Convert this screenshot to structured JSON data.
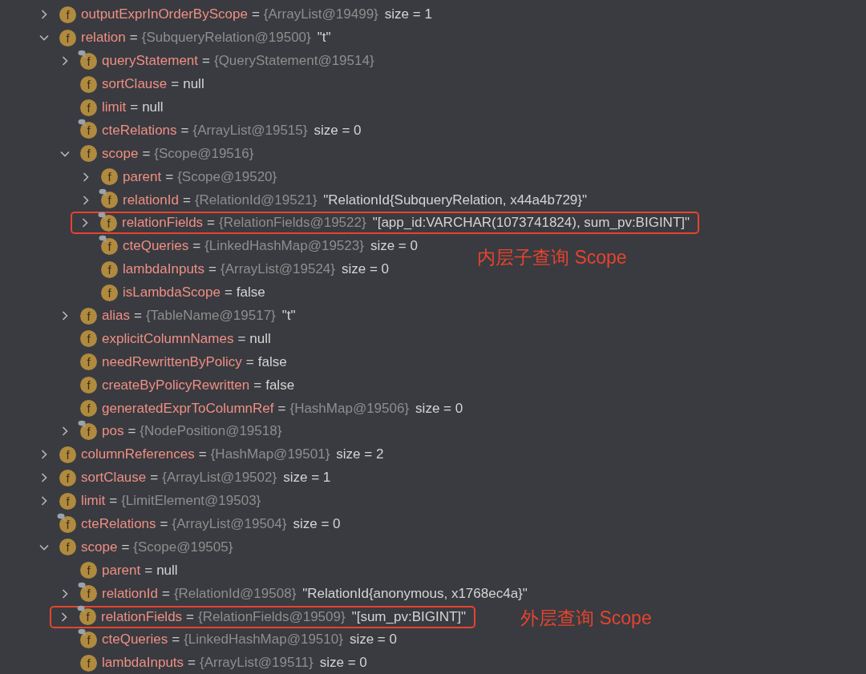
{
  "variables": [
    {
      "icon": "f",
      "name": "outputExprInOrderByScope",
      "eq": "=",
      "type": "{ArrayList@19499}",
      "value": "size = 1",
      "expanded": false,
      "pinned": false,
      "highlighted": false
    },
    {
      "icon": "f",
      "name": "relation",
      "eq": "=",
      "type": "{SubqueryRelation@19500}",
      "value": "\"t\"",
      "expanded": true,
      "pinned": false,
      "highlighted": false,
      "children": [
        {
          "icon": "f",
          "name": "queryStatement",
          "eq": "=",
          "type": "{QueryStatement@19514}",
          "expanded": false,
          "pinned": true,
          "highlighted": false
        },
        {
          "icon": "f",
          "name": "sortClause",
          "eq": "=",
          "value": "null",
          "pinned": false,
          "highlighted": false
        },
        {
          "icon": "f",
          "name": "limit",
          "eq": "=",
          "value": "null",
          "pinned": false,
          "highlighted": false
        },
        {
          "icon": "f",
          "name": "cteRelations",
          "eq": "=",
          "type": "{ArrayList@19515}",
          "value": "size = 0",
          "pinned": true,
          "highlighted": false
        },
        {
          "icon": "f",
          "name": "scope",
          "eq": "=",
          "type": "{Scope@19516}",
          "expanded": true,
          "pinned": false,
          "highlighted": false,
          "children": [
            {
              "icon": "f",
              "name": "parent",
              "eq": "=",
              "type": "{Scope@19520}",
              "expanded": false,
              "pinned": false,
              "highlighted": false
            },
            {
              "icon": "f",
              "name": "relationId",
              "eq": "=",
              "type": "{RelationId@19521}",
              "value": "\"RelationId{SubqueryRelation, x44a4b729}\"",
              "expanded": false,
              "pinned": true,
              "highlighted": false
            },
            {
              "icon": "f",
              "name": "relationFields",
              "eq": "=",
              "type": "{RelationFields@19522}",
              "value": "\"[app_id:VARCHAR(1073741824), sum_pv:BIGINT]\"",
              "expanded": false,
              "pinned": true,
              "highlighted": true,
              "annotation": {
                "text": "内层子查询 Scope",
                "kind": "below"
              }
            },
            {
              "icon": "f",
              "name": "cteQueries",
              "eq": "=",
              "type": "{LinkedHashMap@19523}",
              "value": "size = 0",
              "pinned": true,
              "highlighted": false
            },
            {
              "icon": "f",
              "name": "lambdaInputs",
              "eq": "=",
              "type": "{ArrayList@19524}",
              "value": "size = 0",
              "pinned": false,
              "highlighted": false
            },
            {
              "icon": "f",
              "name": "isLambdaScope",
              "eq": "=",
              "value": "false",
              "pinned": false,
              "highlighted": false
            }
          ]
        },
        {
          "icon": "f",
          "name": "alias",
          "eq": "=",
          "type": "{TableName@19517}",
          "value": "\"t\"",
          "expanded": false,
          "pinned": false,
          "highlighted": false
        },
        {
          "icon": "f",
          "name": "explicitColumnNames",
          "eq": "=",
          "value": "null",
          "pinned": false,
          "highlighted": false
        },
        {
          "icon": "f",
          "name": "needRewrittenByPolicy",
          "eq": "=",
          "value": "false",
          "pinned": false,
          "highlighted": false
        },
        {
          "icon": "f",
          "name": "createByPolicyRewritten",
          "eq": "=",
          "value": "false",
          "pinned": false,
          "highlighted": false
        },
        {
          "icon": "f",
          "name": "generatedExprToColumnRef",
          "eq": "=",
          "type": "{HashMap@19506}",
          "value": "size = 0",
          "pinned": false,
          "highlighted": false
        },
        {
          "icon": "f",
          "name": "pos",
          "eq": "=",
          "type": "{NodePosition@19518}",
          "expanded": false,
          "pinned": true,
          "highlighted": false
        }
      ]
    },
    {
      "icon": "f",
      "name": "columnReferences",
      "eq": "=",
      "type": "{HashMap@19501}",
      "value": "size = 2",
      "expanded": false,
      "pinned": false,
      "highlighted": false
    },
    {
      "icon": "f",
      "name": "sortClause",
      "eq": "=",
      "type": "{ArrayList@19502}",
      "value": "size = 1",
      "expanded": false,
      "pinned": false,
      "highlighted": false
    },
    {
      "icon": "f",
      "name": "limit",
      "eq": "=",
      "type": "{LimitElement@19503}",
      "expanded": false,
      "pinned": false,
      "highlighted": false
    },
    {
      "icon": "f",
      "name": "cteRelations",
      "eq": "=",
      "type": "{ArrayList@19504}",
      "value": "size = 0",
      "pinned": true,
      "highlighted": false
    },
    {
      "icon": "f",
      "name": "scope",
      "eq": "=",
      "type": "{Scope@19505}",
      "expanded": true,
      "pinned": false,
      "highlighted": false,
      "children": [
        {
          "icon": "f",
          "name": "parent",
          "eq": "=",
          "value": "null",
          "pinned": false,
          "highlighted": false
        },
        {
          "icon": "f",
          "name": "relationId",
          "eq": "=",
          "type": "{RelationId@19508}",
          "value": "\"RelationId{anonymous, x1768ec4a}\"",
          "expanded": false,
          "pinned": true,
          "highlighted": false
        },
        {
          "icon": "f",
          "name": "relationFields",
          "eq": "=",
          "type": "{RelationFields@19509}",
          "value": "\"[sum_pv:BIGINT]\"",
          "expanded": false,
          "pinned": true,
          "highlighted": true,
          "annotation": {
            "text": "外层查询 Scope",
            "kind": "beside"
          }
        },
        {
          "icon": "f",
          "name": "cteQueries",
          "eq": "=",
          "type": "{LinkedHashMap@19510}",
          "value": "size = 0",
          "pinned": true,
          "highlighted": false
        },
        {
          "icon": "f",
          "name": "lambdaInputs",
          "eq": "=",
          "type": "{ArrayList@19511}",
          "value": "size = 0",
          "pinned": false,
          "highlighted": false
        }
      ]
    }
  ]
}
